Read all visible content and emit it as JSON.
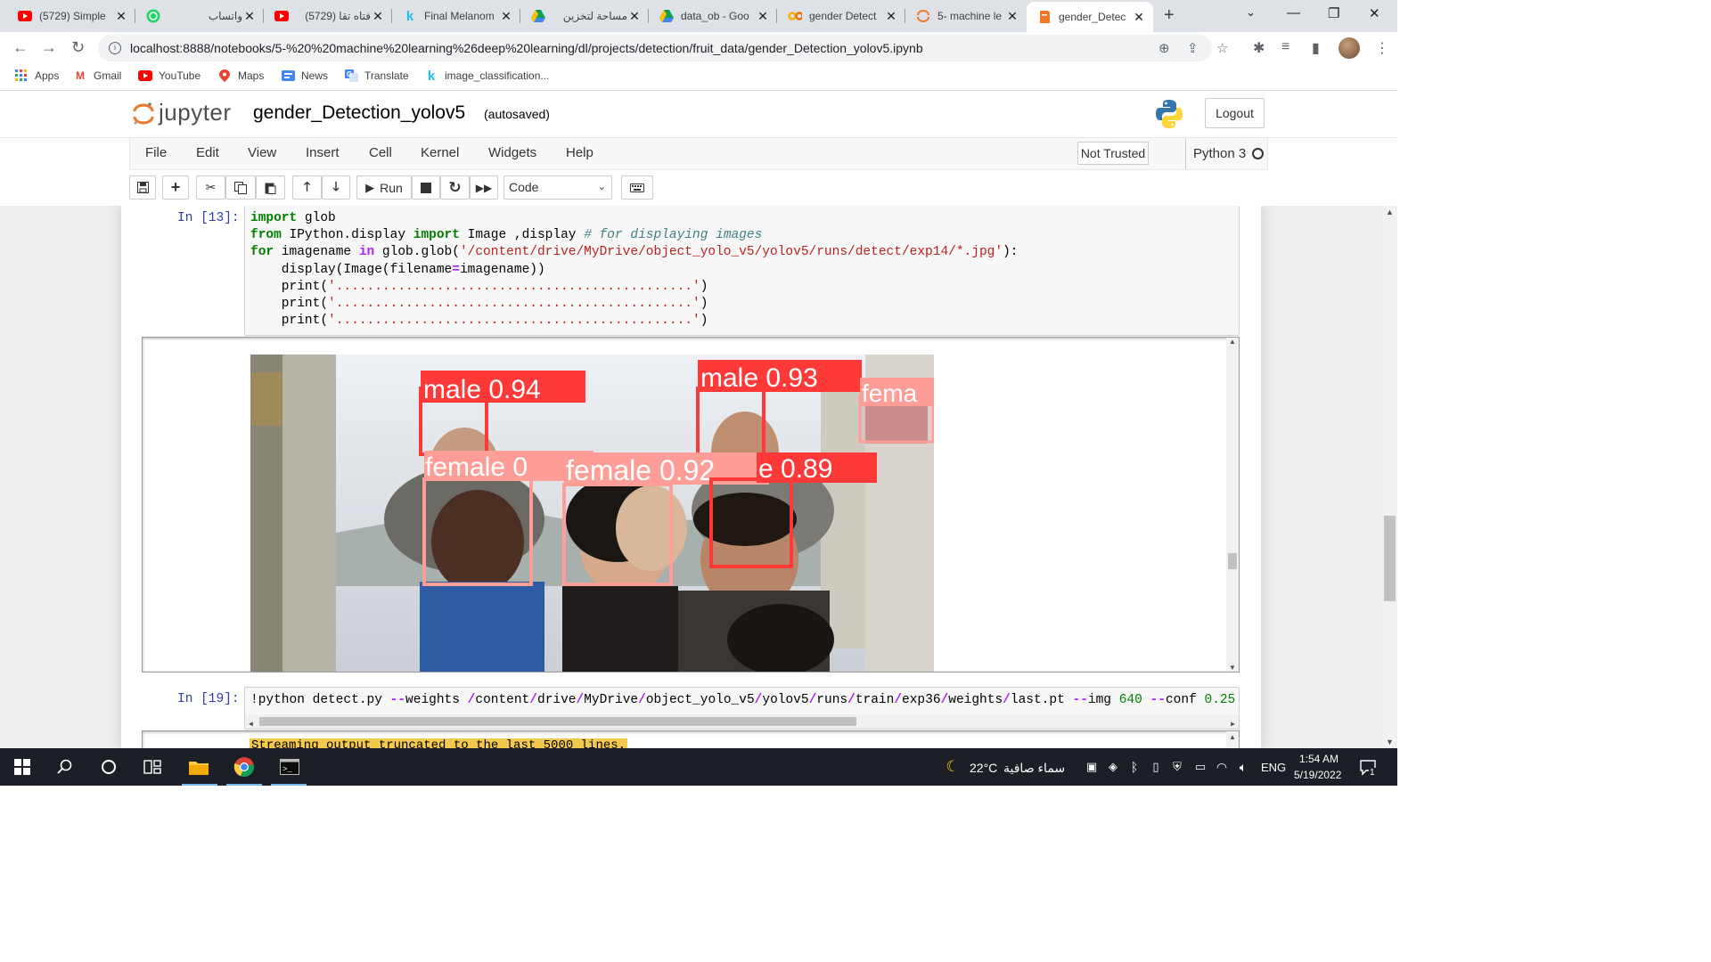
{
  "browser": {
    "tabs": [
      {
        "title": "(5729) Simple",
        "icon": "youtube-icon",
        "color": "#ff0000"
      },
      {
        "title": "واتساب",
        "icon": "whatsapp-icon",
        "color": "#25d366"
      },
      {
        "title": "(5729) فتاه تقا",
        "icon": "youtube-icon",
        "color": "#ff0000"
      },
      {
        "title": "Final Melanom",
        "icon": "kaggle-icon",
        "color": "#20beff"
      },
      {
        "title": "مساحة لتخزين",
        "icon": "google-drive-icon",
        "color": "#0f9d58"
      },
      {
        "title": "data_ob - Goo",
        "icon": "google-drive-icon",
        "color": "#0f9d58"
      },
      {
        "title": "gender Detect",
        "icon": "colab-icon",
        "color": "#f9ab00"
      },
      {
        "title": "5- machine le",
        "icon": "jupyter-icon",
        "color": "#f37726"
      },
      {
        "title": "gender_Detec",
        "icon": "jupyter-notebook-icon",
        "color": "#f37726",
        "active": true
      }
    ],
    "url": "localhost:8888/notebooks/5-%20%20machine%20learning%26deep%20learning/dl/projects/detection/fruit_data/gender_Detection_yolov5.ipynb",
    "bookmarks": [
      {
        "label": "Apps",
        "icon": "apps-grid-icon"
      },
      {
        "label": "Gmail",
        "icon": "gmail-icon"
      },
      {
        "label": "YouTube",
        "icon": "youtube-icon"
      },
      {
        "label": "Maps",
        "icon": "maps-icon"
      },
      {
        "label": "News",
        "icon": "news-icon"
      },
      {
        "label": "Translate",
        "icon": "translate-icon"
      },
      {
        "label": "image_classification...",
        "icon": "kaggle-icon"
      }
    ]
  },
  "jupyter": {
    "logo_text": "jupyter",
    "notebook_title": "gender_Detection_yolov5",
    "save_status": "(autosaved)",
    "logout_label": "Logout",
    "menu": [
      "File",
      "Edit",
      "View",
      "Insert",
      "Cell",
      "Kernel",
      "Widgets",
      "Help"
    ],
    "trust_label": "Not Trusted",
    "kernel_name": "Python 3",
    "run_label": "Run",
    "cell_type": "Code"
  },
  "cells": {
    "cell1": {
      "prompt": "In [13]:",
      "line1_kw": "import",
      "line1_rest": " glob",
      "line2_kw1": "from",
      "line2_mid": " IPython.display ",
      "line2_kw2": "import",
      "line2_rest": " Image ,display ",
      "line2_comment": "# for displaying images",
      "line3_kw1": "for",
      "line3_mid": " imagename ",
      "line3_kw2": "in",
      "line3_pre": " glob.glob(",
      "line3_str": "'/content/drive/MyDrive/object_yolo_v5/yolov5/runs/detect/exp14/*.jpg'",
      "line3_end": "):",
      "line4_pre": "    display(Image(filename",
      "line4_op": "=",
      "line4_end": "imagename))",
      "print_call": "    print(",
      "print_str": "'..............................................'",
      "print_end": ")",
      "output_dots": "..............................................",
      "detections": [
        {
          "label": "male 0.94",
          "color": "#ff3838"
        },
        {
          "label": "male 0.93",
          "color": "#ff3838"
        },
        {
          "label": "fema",
          "color": "#ff9d97"
        },
        {
          "label": "female 0",
          "color": "#ff9d97"
        },
        {
          "label": "female 0.92",
          "color": "#ff9d97"
        },
        {
          "label": "e 0.89",
          "color": "#ff3838"
        }
      ]
    },
    "cell2": {
      "prompt": "In [19]:",
      "cmd_a": "!python detect.py ",
      "cmd_b": "--",
      "cmd_c": "weights ",
      "cmd_d": "/",
      "cmd_e": "content",
      "cmd_f": "/",
      "cmd_g": "drive",
      "cmd_h": "/",
      "cmd_i": "MyDrive",
      "cmd_j": "/",
      "cmd_k": "object_yolo_v5",
      "cmd_l": "/",
      "cmd_m": "yolov5",
      "cmd_n": "/",
      "cmd_o": "runs",
      "cmd_p": "/",
      "cmd_q": "train",
      "cmd_r": "/",
      "cmd_s": "exp36",
      "cmd_t": "/",
      "cmd_u": "weights",
      "cmd_v": "/",
      "cmd_w": "last.pt ",
      "cmd_x": "--",
      "cmd_y": "img ",
      "cmd_z": "640",
      "cmd_aa": " ",
      "cmd_ab": "--",
      "cmd_ac": "conf ",
      "cmd_ad": "0.25",
      "cmd_ae": " -",
      "stream_notice": "Streaming output truncated to the last 5000 lines."
    }
  },
  "taskbar": {
    "weather_temp": "22°C",
    "weather_text": "سماء صافية",
    "language": "ENG",
    "time": "1:54 AM",
    "date": "5/19/2022",
    "notification_count": "1"
  }
}
